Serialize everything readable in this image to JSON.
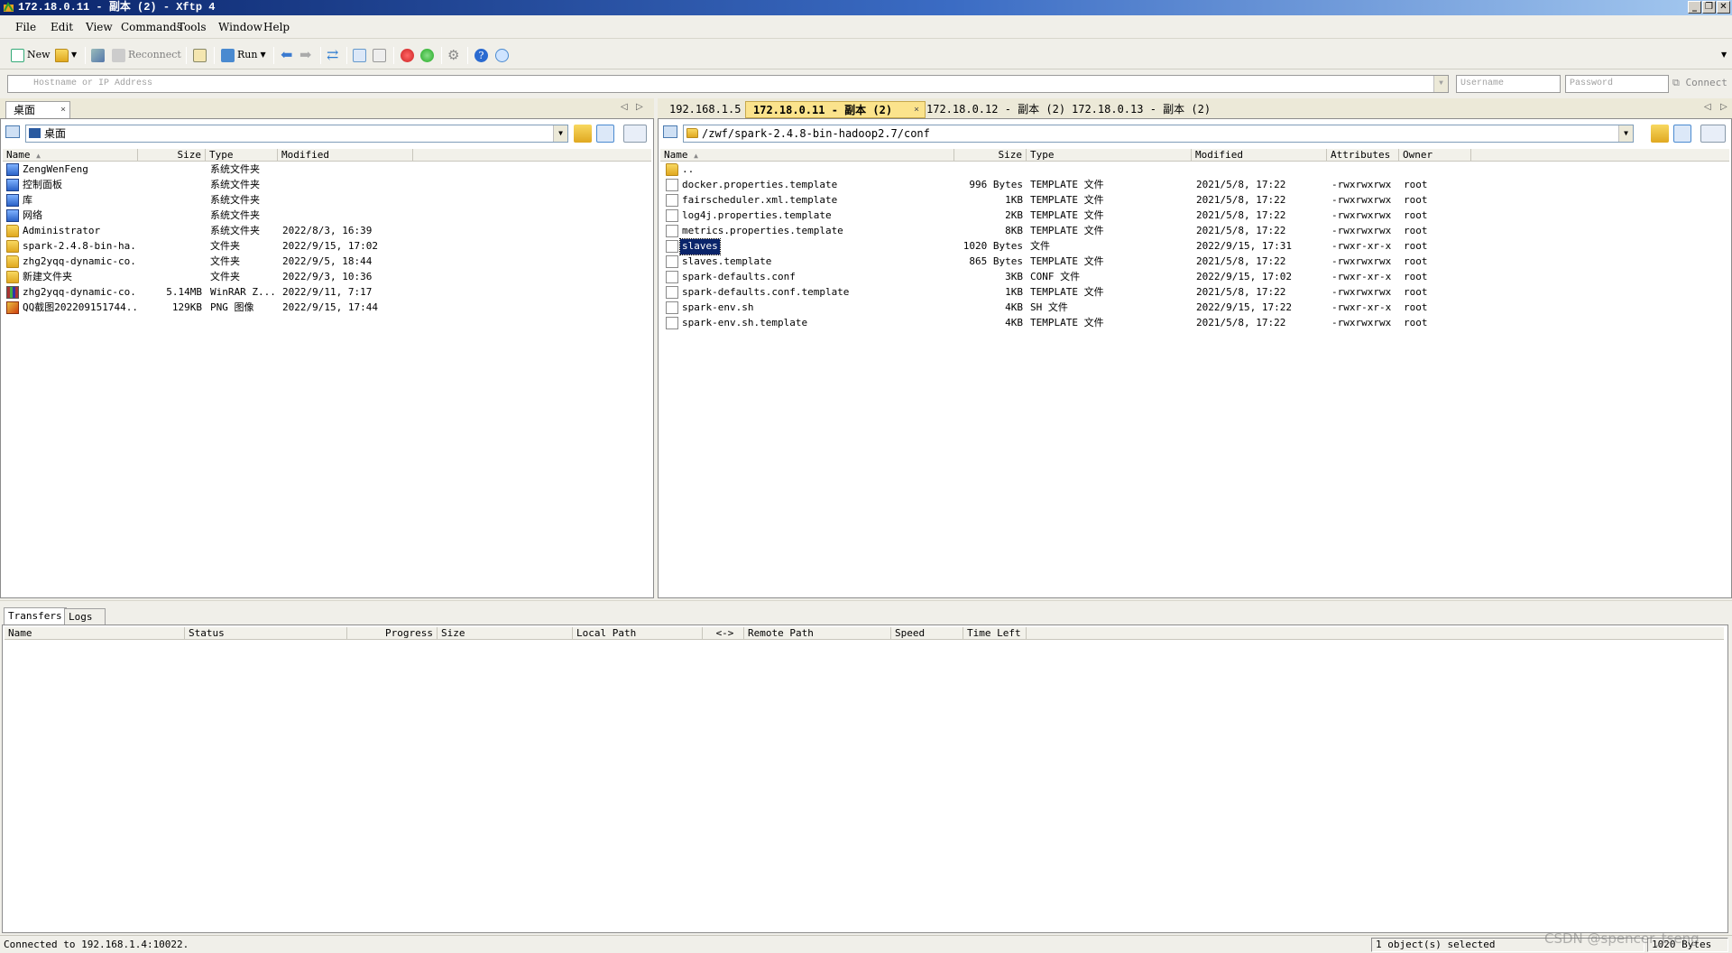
{
  "window": {
    "title": "172.18.0.11 - 副本 (2) - Xftp 4"
  },
  "menu": [
    "File",
    "Edit",
    "View",
    "Commands",
    "Tools",
    "Window",
    "Help"
  ],
  "toolbar": {
    "new_label": "New",
    "reconnect_label": "Reconnect",
    "run_label": "Run"
  },
  "address": {
    "host_placeholder": "Hostname or IP Address",
    "user_placeholder": "Username",
    "pass_placeholder": "Password",
    "connect_label": "Connect"
  },
  "local": {
    "tab": "桌面",
    "path": "桌面",
    "columns": [
      "Name",
      "Size",
      "Type",
      "Modified"
    ],
    "files": [
      {
        "name": "ZengWenFeng",
        "size": "",
        "type": "系统文件夹",
        "modified": "",
        "icon": "sys"
      },
      {
        "name": "控制面板",
        "size": "",
        "type": "系统文件夹",
        "modified": "",
        "icon": "sys"
      },
      {
        "name": "库",
        "size": "",
        "type": "系统文件夹",
        "modified": "",
        "icon": "sys"
      },
      {
        "name": "网络",
        "size": "",
        "type": "系统文件夹",
        "modified": "",
        "icon": "sys"
      },
      {
        "name": "Administrator",
        "size": "",
        "type": "系统文件夹",
        "modified": "2022/8/3, 16:39",
        "icon": "folder"
      },
      {
        "name": "spark-2.4.8-bin-ha...",
        "size": "",
        "type": "文件夹",
        "modified": "2022/9/15, 17:02",
        "icon": "folder"
      },
      {
        "name": "zhg2yqq-dynamic-co...",
        "size": "",
        "type": "文件夹",
        "modified": "2022/9/5, 18:44",
        "icon": "folder"
      },
      {
        "name": "新建文件夹",
        "size": "",
        "type": "文件夹",
        "modified": "2022/9/3, 10:36",
        "icon": "folder"
      },
      {
        "name": "zhg2yqq-dynamic-co...",
        "size": "5.14MB",
        "type": "WinRAR Z...",
        "modified": "2022/9/11, 7:17",
        "icon": "rar"
      },
      {
        "name": "QQ截图202209151744...",
        "size": "129KB",
        "type": "PNG 图像",
        "modified": "2022/9/15, 17:44",
        "icon": "png"
      }
    ]
  },
  "remote": {
    "tabs": [
      {
        "label": "192.168.1.5",
        "active": false
      },
      {
        "label": "172.18.0.11 - 副本 (2)",
        "active": true
      },
      {
        "label": "172.18.0.12 - 副本 (2)",
        "active": false
      },
      {
        "label": "172.18.0.13 - 副本 (2)",
        "active": false
      }
    ],
    "path": "/zwf/spark-2.4.8-bin-hadoop2.7/conf",
    "columns": [
      "Name",
      "Size",
      "Type",
      "Modified",
      "Attributes",
      "Owner"
    ],
    "files": [
      {
        "name": "..",
        "size": "",
        "type": "",
        "modified": "",
        "attr": "",
        "owner": "",
        "icon": "folder"
      },
      {
        "name": "docker.properties.template",
        "size": "996 Bytes",
        "type": "TEMPLATE 文件",
        "modified": "2021/5/8, 17:22",
        "attr": "-rwxrwxrwx",
        "owner": "root",
        "icon": "file"
      },
      {
        "name": "fairscheduler.xml.template",
        "size": "1KB",
        "type": "TEMPLATE 文件",
        "modified": "2021/5/8, 17:22",
        "attr": "-rwxrwxrwx",
        "owner": "root",
        "icon": "file"
      },
      {
        "name": "log4j.properties.template",
        "size": "2KB",
        "type": "TEMPLATE 文件",
        "modified": "2021/5/8, 17:22",
        "attr": "-rwxrwxrwx",
        "owner": "root",
        "icon": "file"
      },
      {
        "name": "metrics.properties.template",
        "size": "8KB",
        "type": "TEMPLATE 文件",
        "modified": "2021/5/8, 17:22",
        "attr": "-rwxrwxrwx",
        "owner": "root",
        "icon": "file"
      },
      {
        "name": "slaves",
        "size": "1020 Bytes",
        "type": "文件",
        "modified": "2022/9/15, 17:31",
        "attr": "-rwxr-xr-x",
        "owner": "root",
        "icon": "file",
        "selected": true
      },
      {
        "name": "slaves.template",
        "size": "865 Bytes",
        "type": "TEMPLATE 文件",
        "modified": "2021/5/8, 17:22",
        "attr": "-rwxrwxrwx",
        "owner": "root",
        "icon": "file"
      },
      {
        "name": "spark-defaults.conf",
        "size": "3KB",
        "type": "CONF 文件",
        "modified": "2022/9/15, 17:02",
        "attr": "-rwxr-xr-x",
        "owner": "root",
        "icon": "file"
      },
      {
        "name": "spark-defaults.conf.template",
        "size": "1KB",
        "type": "TEMPLATE 文件",
        "modified": "2021/5/8, 17:22",
        "attr": "-rwxrwxrwx",
        "owner": "root",
        "icon": "file"
      },
      {
        "name": "spark-env.sh",
        "size": "4KB",
        "type": "SH 文件",
        "modified": "2022/9/15, 17:22",
        "attr": "-rwxr-xr-x",
        "owner": "root",
        "icon": "file"
      },
      {
        "name": "spark-env.sh.template",
        "size": "4KB",
        "type": "TEMPLATE 文件",
        "modified": "2021/5/8, 17:22",
        "attr": "-rwxrwxrwx",
        "owner": "root",
        "icon": "file"
      }
    ]
  },
  "transfers": {
    "tabs": [
      "Transfers",
      "Logs"
    ],
    "columns": [
      "Name",
      "Status",
      "Progress",
      "Size",
      "Local Path",
      "<->",
      "Remote Path",
      "Speed",
      "Time Left"
    ]
  },
  "status": {
    "left": "Connected to 192.168.1.4:10022.",
    "middle": "1 object(s) selected",
    "right": "1020 Bytes",
    "watermark": "CSDN @spencer_tseng"
  }
}
